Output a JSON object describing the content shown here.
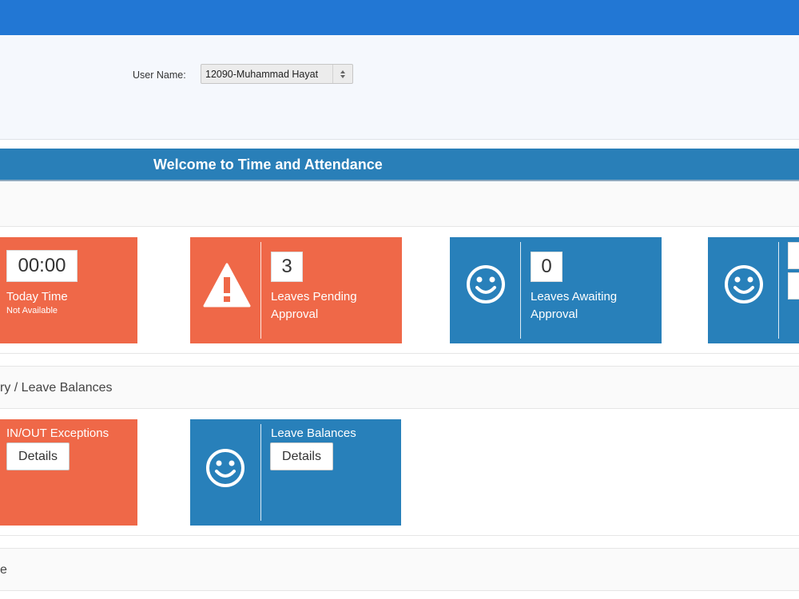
{
  "filter": {
    "user_label": "User Name:",
    "user_value": "12090-Muhammad Hayat"
  },
  "welcome": {
    "title": "Welcome to Time and Attendance"
  },
  "sections": {
    "summary_title": "ry / Leave Balances",
    "bottom_title": "e"
  },
  "tiles": {
    "today": {
      "value": "00:00",
      "label": "Today Time",
      "sub": "Not Available"
    },
    "pending": {
      "value": "3",
      "label_line1": "Leaves Pending",
      "label_line2": "Approval",
      "icon": "warning-icon"
    },
    "awaiting": {
      "value": "0",
      "label_line1": "Leaves Awaiting",
      "label_line2": "Approval",
      "icon": "smiley-icon"
    },
    "fourth": {
      "icon": "smiley-icon"
    },
    "exceptions": {
      "label": "IN/OUT Exceptions",
      "button": "Details"
    },
    "balances": {
      "label": "Leave Balances",
      "button": "Details",
      "icon": "smiley-icon"
    }
  },
  "colors": {
    "topbar": "#2277d4",
    "orange": "#ef6848",
    "blue": "#2880ba"
  }
}
